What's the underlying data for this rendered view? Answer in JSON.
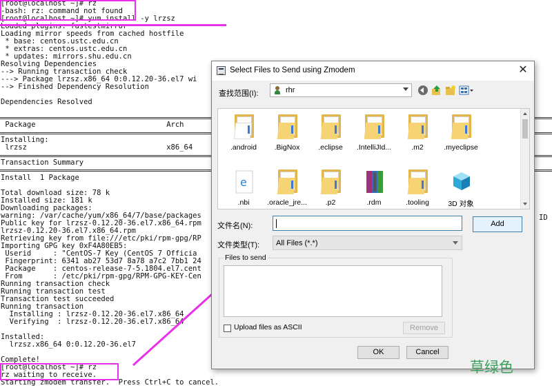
{
  "terminal": {
    "lines": [
      "[root@localhost ~]# rz",
      "-bash: rz: command not found",
      "[root@localhost ~]# yum install -y lrzsz",
      "Loaded plugins: fastestmirror",
      "Loading mirror speeds from cached hostfile",
      " * base: centos.ustc.edu.cn",
      " * extras: centos.ustc.edu.cn",
      " * updates: mirrors.shu.edu.cn",
      "Resolving Dependencies",
      "--> Running transaction check",
      "---> Package lrzsz.x86_64 0:0.12.20-36.el7 wi",
      "--> Finished Dependency Resolution",
      "",
      "Dependencies Resolved",
      "",
      "",
      " Package                              Arch                                                                     ositi",
      "",
      "Installing:",
      " lrzsz                                x86_64                                                                   e",
      "",
      "Transaction Summary",
      "",
      "Install  1 Package",
      "",
      "Total download size: 78 k",
      "Installed size: 181 k",
      "Downloading packages:",
      "warning: /var/cache/yum/x86_64/7/base/packages",
      "Public key for lrzsz-0.12.20-36.el7.x86_64.rpm",
      "lrzsz-0.12.20-36.el7.x86_64.rpm",
      "Retrieving key from file:///etc/pki/rpm-gpg/RP",
      "Importing GPG key 0xF4A80EB5:",
      " Userid     : \"CentOS-7 Key (CentOS 7 Officia",
      " Fingerprint: 6341 ab27 53d7 8a78 a7c2 7bb1 24",
      " Package    : centos-release-7-5.1804.el7.cent",
      " From       : /etc/pki/rpm-gpg/RPM-GPG-KEY-Cen",
      "Running transaction check",
      "Running transaction test",
      "Transaction test succeeded",
      "Running transaction",
      "  Installing : lrzsz-0.12.20-36.el7.x86_64",
      "  Verifying  : lrzsz-0.12.20-36.el7.x86_64",
      "",
      "Installed:",
      "  lrzsz.x86_64 0:0.12.20-36.el7",
      "",
      "Complete!",
      "[root@localhost ~]# rz",
      "rz waiting to receive.",
      "Starting zmodem transfer.  Press Ctrl+C to cancel."
    ],
    "right_fragment": "ID"
  },
  "dialog": {
    "title": "Select Files to Send using Zmodem",
    "close_label": "✕",
    "look_in_label": "查找范围(I):",
    "look_in_value": "rhr",
    "toolbar_icons": [
      "back-icon",
      "up-folder-icon",
      "new-folder-icon",
      "view-menu-icon"
    ],
    "files": [
      {
        "name": ".android",
        "icon": "file-icon"
      },
      {
        "name": ".BigNox",
        "icon": "folder-icon"
      },
      {
        "name": ".eclipse",
        "icon": "folder-icon"
      },
      {
        "name": ".IntelliJId...",
        "icon": "folder-icon"
      },
      {
        "name": ".m2",
        "icon": "folder-icon"
      },
      {
        "name": ".myeclipse",
        "icon": "folder-icon"
      },
      {
        "name": ".nbi",
        "icon": "ie-file-icon"
      },
      {
        "name": ".oracle_jre...",
        "icon": "folder-icon"
      },
      {
        "name": ".p2",
        "icon": "folder-icon"
      },
      {
        "name": ".rdm",
        "icon": "archive-icon"
      },
      {
        "name": ".tooling",
        "icon": "folder-icon"
      },
      {
        "name": "3D 对象",
        "icon": "3d-objects-icon"
      }
    ],
    "filename_label": "文件名(N):",
    "filename_value": "",
    "add_button": "Add",
    "filetype_label": "文件类型(T):",
    "filetype_value": "All Files (*.*)",
    "files_to_send_label": "Files to send",
    "ascii_label": "Upload files as ASCII",
    "ascii_checked": false,
    "remove_button": "Remove",
    "ok_button": "OK",
    "cancel_button": "Cancel"
  },
  "watermark": "草绿色",
  "colors": {
    "highlight": "#e830e8",
    "folder": "#f6d475",
    "watermark": "#3aa05a"
  }
}
